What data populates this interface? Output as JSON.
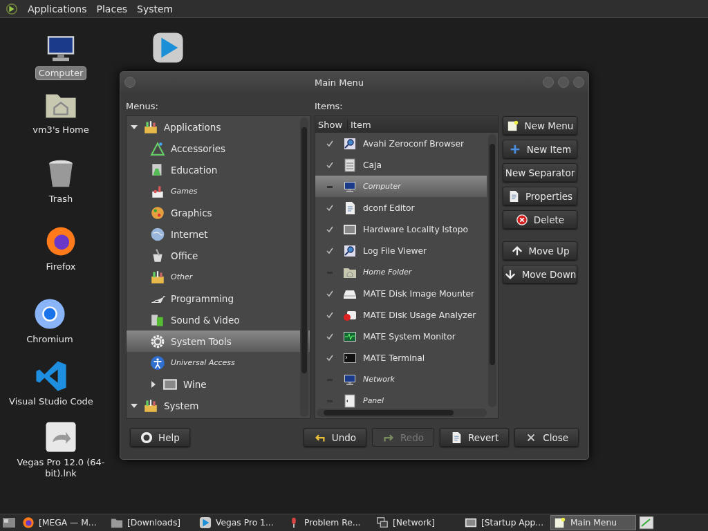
{
  "top_panel": {
    "menus": [
      "Applications",
      "Places",
      "System"
    ]
  },
  "desktop_icons": [
    {
      "label": "Computer",
      "kind": "monitor",
      "selected": true
    },
    {
      "label": "vm3's Home",
      "kind": "home-folder",
      "selected": false
    },
    {
      "label": "Trash",
      "kind": "trash",
      "selected": false
    },
    {
      "label": "Firefox",
      "kind": "firefox",
      "selected": false
    },
    {
      "label": "Chromium",
      "kind": "chromium",
      "selected": false
    },
    {
      "label": "Visual Studio Code",
      "kind": "vscode",
      "selected": false
    },
    {
      "label": "Vegas Pro 12.0 (64-bit).lnk",
      "kind": "shortcut",
      "selected": false
    }
  ],
  "desktop_play_icon": {
    "kind": "play"
  },
  "window": {
    "title": "Main Menu",
    "menus_label": "Menus:",
    "items_label": "Items:",
    "menu_tree": [
      {
        "label": "Applications",
        "kind": "toolbox",
        "hidden": false,
        "selected": false,
        "expanded": true,
        "children": [
          {
            "label": "Accessories",
            "kind": "tools",
            "hidden": false,
            "selected": false
          },
          {
            "label": "Education",
            "kind": "flask",
            "hidden": false,
            "selected": false
          },
          {
            "label": "Games",
            "kind": "games",
            "hidden": true,
            "selected": false
          },
          {
            "label": "Graphics",
            "kind": "palette",
            "hidden": false,
            "selected": false
          },
          {
            "label": "Internet",
            "kind": "globe",
            "hidden": false,
            "selected": false
          },
          {
            "label": "Office",
            "kind": "office",
            "hidden": false,
            "selected": false
          },
          {
            "label": "Other",
            "kind": "toolbox",
            "hidden": true,
            "selected": false
          },
          {
            "label": "Programming",
            "kind": "lamp",
            "hidden": false,
            "selected": false
          },
          {
            "label": "Sound & Video",
            "kind": "film",
            "hidden": false,
            "selected": false
          },
          {
            "label": "System Tools",
            "kind": "gear",
            "hidden": false,
            "selected": true
          },
          {
            "label": "Universal Access",
            "kind": "person",
            "hidden": true,
            "selected": false
          },
          {
            "label": "Wine",
            "kind": "screen",
            "hidden": false,
            "selected": false,
            "expanded": false
          }
        ]
      },
      {
        "label": "System",
        "kind": "toolbox",
        "hidden": false,
        "selected": false,
        "expanded": true
      }
    ],
    "columns": [
      "Show",
      "Item"
    ],
    "items": [
      {
        "label": "Avahi Zeroconf Browser",
        "kind": "magnifier",
        "show": true,
        "selected": false
      },
      {
        "label": "Caja",
        "kind": "cabinet",
        "show": true,
        "selected": false
      },
      {
        "label": "Computer",
        "kind": "monitor",
        "show": false,
        "selected": true
      },
      {
        "label": "dconf Editor",
        "kind": "document",
        "show": true,
        "selected": false
      },
      {
        "label": "Hardware Locality lstopo",
        "kind": "screen",
        "show": true,
        "selected": false
      },
      {
        "label": "Log File Viewer",
        "kind": "magnifier",
        "show": true,
        "selected": false
      },
      {
        "label": "Home Folder",
        "kind": "home-folder",
        "show": false,
        "selected": false
      },
      {
        "label": "MATE Disk Image Mounter",
        "kind": "drive",
        "show": true,
        "selected": false
      },
      {
        "label": "MATE Disk Usage Analyzer",
        "kind": "pie",
        "show": true,
        "selected": false
      },
      {
        "label": "MATE System Monitor",
        "kind": "pulse",
        "show": true,
        "selected": false
      },
      {
        "label": "MATE Terminal",
        "kind": "terminal",
        "show": true,
        "selected": false
      },
      {
        "label": "Network",
        "kind": "monitor",
        "show": false,
        "selected": false
      },
      {
        "label": "Panel",
        "kind": "panel",
        "show": false,
        "selected": false
      }
    ],
    "side_buttons": [
      [
        {
          "label": "New Menu",
          "kind": "note"
        },
        {
          "label": "New Item",
          "kind": "plus"
        },
        {
          "label": "New Separator",
          "kind": "none"
        },
        {
          "label": "Properties",
          "kind": "document"
        },
        {
          "label": "Delete",
          "kind": "delete"
        }
      ],
      [
        {
          "label": "Move Up",
          "kind": "up"
        },
        {
          "label": "Move Down",
          "kind": "down"
        }
      ]
    ],
    "help_button": {
      "label": "Help",
      "kind": "help"
    },
    "bottom_buttons": [
      {
        "label": "Undo",
        "kind": "undo",
        "disabled": false
      },
      {
        "label": "Redo",
        "kind": "redo",
        "disabled": true
      },
      {
        "label": "Revert",
        "kind": "document",
        "disabled": false
      },
      {
        "label": "Close",
        "kind": "close",
        "disabled": false
      }
    ]
  },
  "taskbar": {
    "items": [
      {
        "label": "[MEGA — M...",
        "kind": "firefox",
        "selected": false
      },
      {
        "label": "[Downloads]",
        "kind": "folder",
        "selected": false
      },
      {
        "label": "Vegas Pro 1...",
        "kind": "play",
        "selected": false
      },
      {
        "label": "Problem Re...",
        "kind": "mic",
        "selected": false
      },
      {
        "label": "[Network]",
        "kind": "windows",
        "selected": false
      },
      {
        "label": "[Startup App...",
        "kind": "screen",
        "selected": false
      },
      {
        "label": "Main Menu",
        "kind": "note",
        "selected": true
      }
    ]
  }
}
